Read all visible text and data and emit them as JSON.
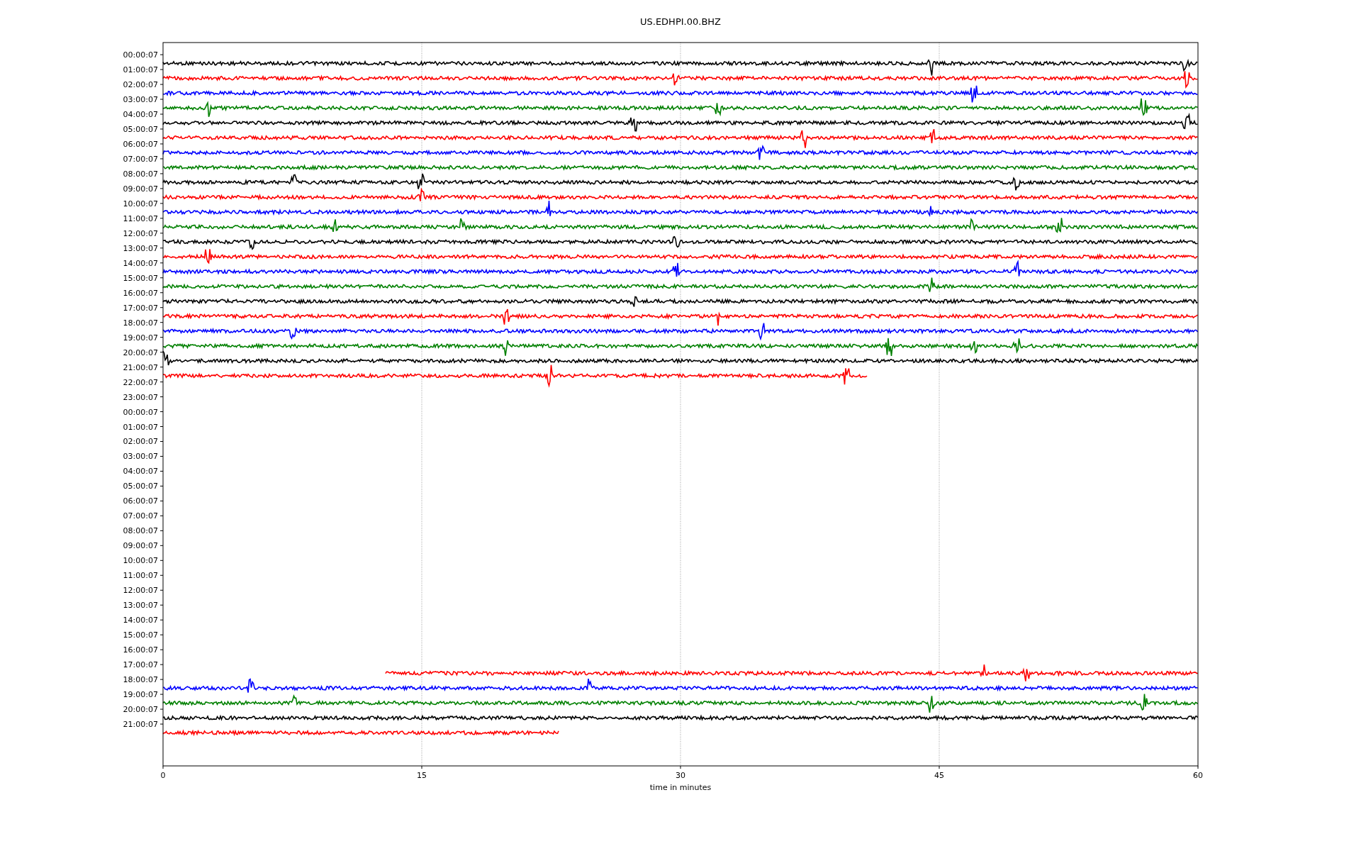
{
  "title": "US.EDHPI.00.BHZ",
  "xlabel": "time in minutes",
  "xticks": [
    "0",
    "15",
    "30",
    "45",
    "60"
  ],
  "rows": [
    {
      "label": "00:00:07",
      "trace": {
        "color": "#000000",
        "kind": "full"
      }
    },
    {
      "label": "01:00:07",
      "trace": {
        "color": "#ff0000",
        "kind": "full"
      }
    },
    {
      "label": "02:00:07",
      "trace": {
        "color": "#0000ff",
        "kind": "full"
      }
    },
    {
      "label": "03:00:07",
      "trace": {
        "color": "#008000",
        "kind": "full"
      }
    },
    {
      "label": "04:00:07",
      "trace": {
        "color": "#000000",
        "kind": "full"
      }
    },
    {
      "label": "05:00:07",
      "trace": {
        "color": "#ff0000",
        "kind": "full"
      }
    },
    {
      "label": "06:00:07",
      "trace": {
        "color": "#0000ff",
        "kind": "full"
      }
    },
    {
      "label": "07:00:07",
      "trace": {
        "color": "#008000",
        "kind": "full"
      }
    },
    {
      "label": "08:00:07",
      "trace": {
        "color": "#000000",
        "kind": "full"
      }
    },
    {
      "label": "09:00:07",
      "trace": {
        "color": "#ff0000",
        "kind": "full"
      }
    },
    {
      "label": "10:00:07",
      "trace": {
        "color": "#0000ff",
        "kind": "full"
      }
    },
    {
      "label": "11:00:07",
      "trace": {
        "color": "#008000",
        "kind": "full"
      }
    },
    {
      "label": "12:00:07",
      "trace": {
        "color": "#000000",
        "kind": "full"
      }
    },
    {
      "label": "13:00:07",
      "trace": {
        "color": "#ff0000",
        "kind": "full"
      }
    },
    {
      "label": "14:00:07",
      "trace": {
        "color": "#0000ff",
        "kind": "full"
      }
    },
    {
      "label": "15:00:07",
      "trace": {
        "color": "#008000",
        "kind": "full"
      }
    },
    {
      "label": "16:00:07",
      "trace": {
        "color": "#000000",
        "kind": "full"
      }
    },
    {
      "label": "17:00:07",
      "trace": {
        "color": "#ff0000",
        "kind": "full"
      }
    },
    {
      "label": "18:00:07",
      "trace": {
        "color": "#0000ff",
        "kind": "full"
      }
    },
    {
      "label": "19:00:07",
      "trace": {
        "color": "#008000",
        "kind": "full"
      }
    },
    {
      "label": "20:00:07",
      "trace": {
        "color": "#000000",
        "kind": "full"
      }
    },
    {
      "label": "21:00:07",
      "trace": {
        "color": "#ff0000",
        "kind": "ends-early"
      }
    },
    {
      "label": "22:00:07"
    },
    {
      "label": "23:00:07"
    },
    {
      "label": "00:00:07"
    },
    {
      "label": "01:00:07"
    },
    {
      "label": "02:00:07"
    },
    {
      "label": "03:00:07"
    },
    {
      "label": "04:00:07"
    },
    {
      "label": "05:00:07"
    },
    {
      "label": "06:00:07"
    },
    {
      "label": "07:00:07"
    },
    {
      "label": "08:00:07"
    },
    {
      "label": "09:00:07"
    },
    {
      "label": "10:00:07"
    },
    {
      "label": "11:00:07"
    },
    {
      "label": "12:00:07"
    },
    {
      "label": "13:00:07"
    },
    {
      "label": "14:00:07"
    },
    {
      "label": "15:00:07"
    },
    {
      "label": "16:00:07"
    },
    {
      "label": "17:00:07",
      "trace": {
        "color": "#ff0000",
        "kind": "starts-late"
      }
    },
    {
      "label": "18:00:07",
      "trace": {
        "color": "#0000ff",
        "kind": "full"
      }
    },
    {
      "label": "19:00:07",
      "trace": {
        "color": "#008000",
        "kind": "full"
      }
    },
    {
      "label": "20:00:07",
      "trace": {
        "color": "#000000",
        "kind": "full"
      }
    },
    {
      "label": "21:00:07",
      "trace": {
        "color": "#ff0000",
        "kind": "short"
      }
    }
  ]
}
